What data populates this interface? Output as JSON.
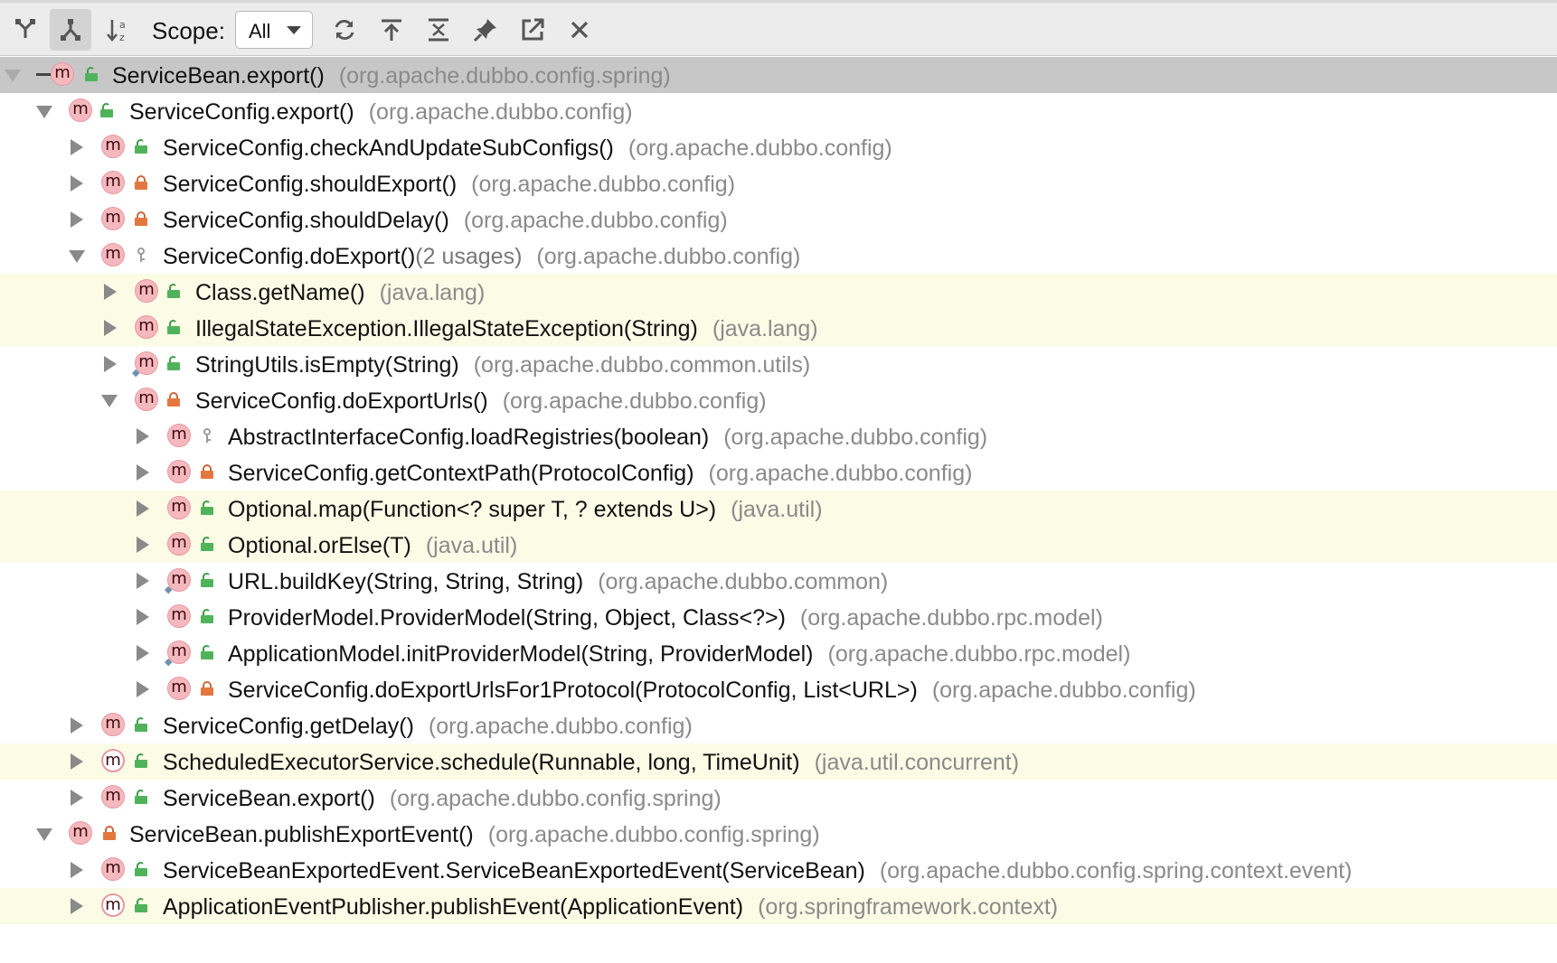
{
  "toolbar": {
    "scope_label": "Scope:",
    "scope_value": "All",
    "buttons": [
      {
        "icon": "caller-hierarchy-icon"
      },
      {
        "icon": "callee-hierarchy-icon",
        "active": true
      },
      {
        "icon": "sort-alphabetically-icon"
      },
      {
        "icon": "refresh-icon"
      },
      {
        "icon": "expand-all-icon"
      },
      {
        "icon": "collapse-all-icon"
      },
      {
        "icon": "pin-icon"
      },
      {
        "icon": "export-icon"
      },
      {
        "icon": "close-icon"
      }
    ]
  },
  "rows": [
    {
      "method": "ServiceBean.export()",
      "usages": "",
      "package": "(org.apache.dubbo.config.spring)"
    },
    {
      "method": "ServiceConfig.export()",
      "usages": "",
      "package": "(org.apache.dubbo.config)"
    },
    {
      "method": "ServiceConfig.checkAndUpdateSubConfigs()",
      "usages": "",
      "package": "(org.apache.dubbo.config)"
    },
    {
      "method": "ServiceConfig.shouldExport()",
      "usages": "",
      "package": "(org.apache.dubbo.config)"
    },
    {
      "method": "ServiceConfig.shouldDelay()",
      "usages": "",
      "package": "(org.apache.dubbo.config)"
    },
    {
      "method": "ServiceConfig.doExport()",
      "usages": "(2 usages)",
      "package": "(org.apache.dubbo.config)"
    },
    {
      "method": "Class.getName()",
      "usages": "",
      "package": "(java.lang)"
    },
    {
      "method": "IllegalStateException.IllegalStateException(String)",
      "usages": "",
      "package": "(java.lang)"
    },
    {
      "method": "StringUtils.isEmpty(String)",
      "usages": "",
      "package": "(org.apache.dubbo.common.utils)"
    },
    {
      "method": "ServiceConfig.doExportUrls()",
      "usages": "",
      "package": "(org.apache.dubbo.config)"
    },
    {
      "method": "AbstractInterfaceConfig.loadRegistries(boolean)",
      "usages": "",
      "package": "(org.apache.dubbo.config)"
    },
    {
      "method": "ServiceConfig.getContextPath(ProtocolConfig)",
      "usages": "",
      "package": "(org.apache.dubbo.config)"
    },
    {
      "method": "Optional.map(Function<? super T, ? extends U>)",
      "usages": "",
      "package": "(java.util)"
    },
    {
      "method": "Optional.orElse(T)",
      "usages": "",
      "package": "(java.util)"
    },
    {
      "method": "URL.buildKey(String, String, String)",
      "usages": "",
      "package": "(org.apache.dubbo.common)"
    },
    {
      "method": "ProviderModel.ProviderModel(String, Object, Class<?>)",
      "usages": "",
      "package": "(org.apache.dubbo.rpc.model)"
    },
    {
      "method": "ApplicationModel.initProviderModel(String, ProviderModel)",
      "usages": "",
      "package": "(org.apache.dubbo.rpc.model)"
    },
    {
      "method": "ServiceConfig.doExportUrlsFor1Protocol(ProtocolConfig, List<URL>)",
      "usages": "",
      "package": "(org.apache.dubbo.config)"
    },
    {
      "method": "ServiceConfig.getDelay()",
      "usages": "",
      "package": "(org.apache.dubbo.config)"
    },
    {
      "method": "ScheduledExecutorService.schedule(Runnable, long, TimeUnit)",
      "usages": "",
      "package": "(java.util.concurrent)"
    },
    {
      "method": "ServiceBean.export()",
      "usages": "",
      "package": "(org.apache.dubbo.config.spring)"
    },
    {
      "method": "ServiceBean.publishExportEvent()",
      "usages": "",
      "package": "(org.apache.dubbo.config.spring)"
    },
    {
      "method": "ServiceBeanExportedEvent.ServiceBeanExportedEvent(ServiceBean)",
      "usages": "",
      "package": "(org.apache.dubbo.config.spring.context.event)"
    },
    {
      "method": "ApplicationEventPublisher.publishEvent(ApplicationEvent)",
      "usages": "",
      "package": "(org.springframework.context)"
    }
  ]
}
